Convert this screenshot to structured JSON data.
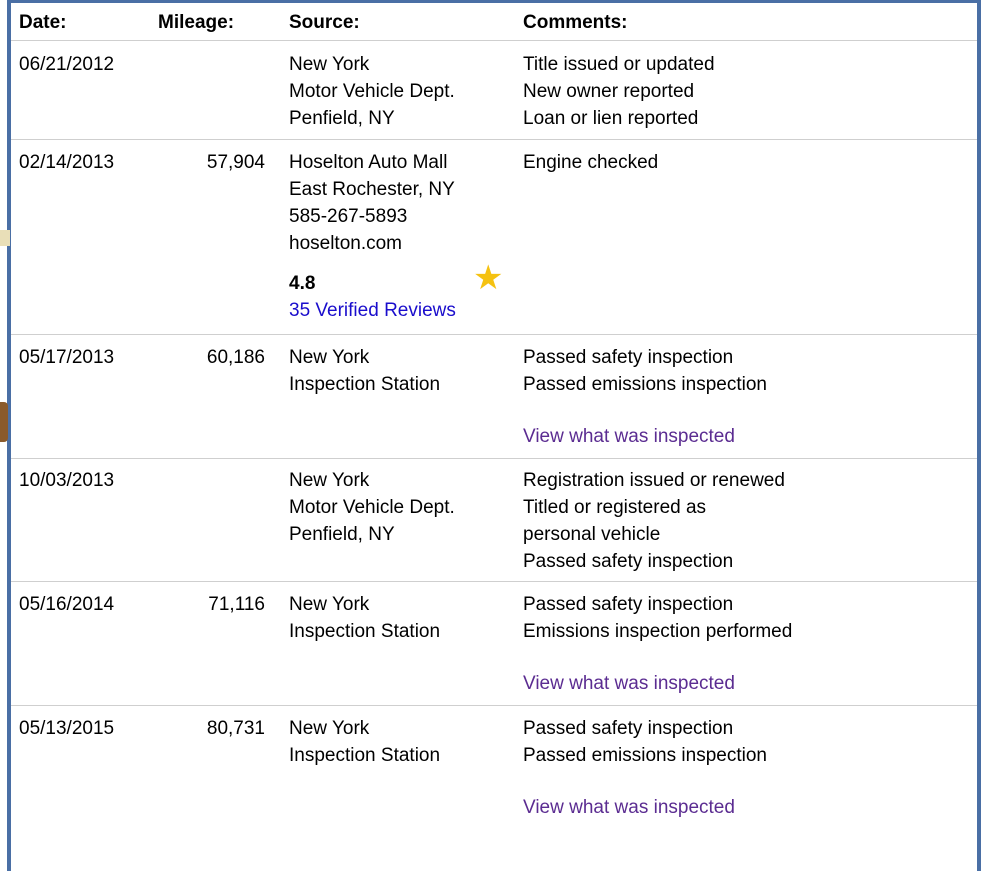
{
  "headers": {
    "date": "Date:",
    "mileage": "Mileage:",
    "source": "Source:",
    "comments": "Comments:"
  },
  "rows": [
    {
      "date": "06/21/2012",
      "mileage": "",
      "source": [
        "New York",
        "Motor Vehicle Dept.",
        "Penfield, NY"
      ],
      "comments": [
        "Title issued or updated",
        "New owner reported",
        "Loan or lien reported"
      ]
    },
    {
      "date": "02/14/2013",
      "mileage": "57,904",
      "source": [
        "Hoselton Auto Mall",
        "East Rochester, NY",
        "585-267-5893",
        "hoselton.com"
      ],
      "rating": "4.8",
      "reviews_link": "35 Verified Reviews",
      "comments": [
        "Engine checked"
      ]
    },
    {
      "date": "05/17/2013",
      "mileage": "60,186",
      "source": [
        "New York",
        "Inspection Station"
      ],
      "comments": [
        "Passed safety inspection",
        "Passed emissions inspection"
      ],
      "link": "View what was inspected"
    },
    {
      "date": "10/03/2013",
      "mileage": "",
      "source": [
        "New York",
        "Motor Vehicle Dept.",
        "Penfield, NY"
      ],
      "comments": [
        "Registration issued or renewed",
        "Titled or registered as",
        "personal vehicle",
        "Passed safety inspection"
      ]
    },
    {
      "date": "05/16/2014",
      "mileage": "71,116",
      "source": [
        "New York",
        "Inspection Station"
      ],
      "comments": [
        "Passed safety inspection",
        "Emissions inspection performed"
      ],
      "link": "View what was inspected"
    },
    {
      "date": "05/13/2015",
      "mileage": "80,731",
      "source": [
        "New York",
        "Inspection Station"
      ],
      "comments": [
        "Passed safety inspection",
        "Passed emissions inspection"
      ],
      "link": "View what was inspected"
    }
  ],
  "colors": {
    "frame": "#4a6fa5",
    "link_blue": "#1a0dcc",
    "link_visited": "#5b2c91",
    "star": "#f5c211"
  },
  "icons": {
    "rating": "star-icon"
  }
}
